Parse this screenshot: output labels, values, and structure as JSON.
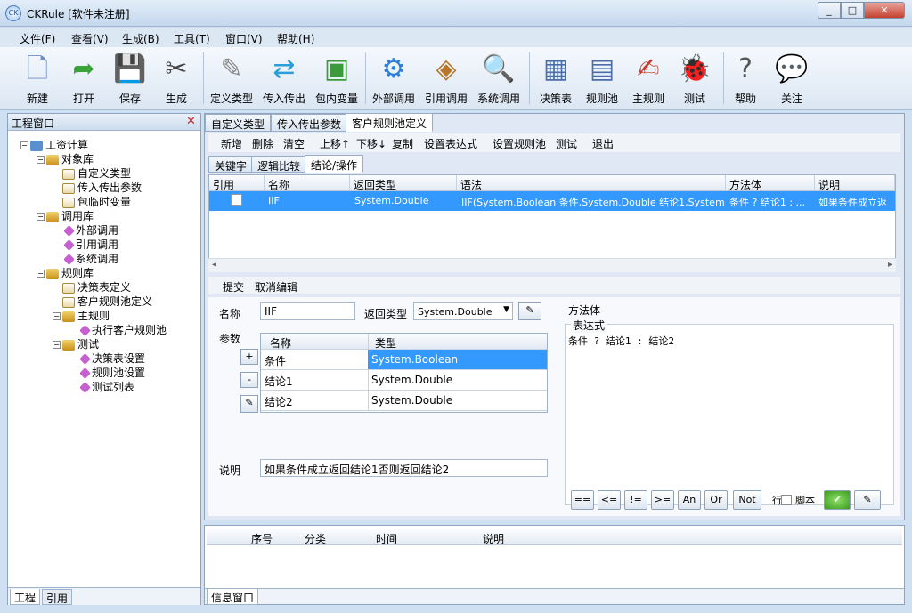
{
  "window": {
    "title": "CKRule [软件未注册]",
    "app_icon": "CK"
  },
  "menu": [
    "文件(F)",
    "查看(V)",
    "生成(B)",
    "工具(T)",
    "窗口(V)",
    "帮助(H)"
  ],
  "toolbar": [
    {
      "label": "新建",
      "icon": "new-file-icon"
    },
    {
      "label": "打开",
      "icon": "open-arrow-icon"
    },
    {
      "label": "保存",
      "icon": "floppy-save-icon"
    },
    {
      "label": "生成",
      "icon": "tools-build-icon"
    },
    {
      "label": "定义类型",
      "icon": "define-type-icon"
    },
    {
      "label": "传入传出",
      "icon": "in-out-arrows-icon"
    },
    {
      "label": "包内变量",
      "icon": "package-variable-icon"
    },
    {
      "label": "外部调用",
      "icon": "gear-external-call-icon"
    },
    {
      "label": "引用调用",
      "icon": "box-reference-icon"
    },
    {
      "label": "系统调用",
      "icon": "magnifier-system-icon"
    },
    {
      "label": "决策表",
      "icon": "decision-table-icon"
    },
    {
      "label": "规则池",
      "icon": "rule-pool-icon"
    },
    {
      "label": "主规则",
      "icon": "main-rule-icon"
    },
    {
      "label": "测试",
      "icon": "ladybug-test-icon"
    },
    {
      "label": "帮助",
      "icon": "help-question-icon"
    },
    {
      "label": "关注",
      "icon": "follow-icon"
    }
  ],
  "left_panel": {
    "title": "工程窗口",
    "tree": [
      {
        "label": "工资计算",
        "level": 0,
        "kind": "root",
        "expanded": true
      },
      {
        "label": "对象库",
        "level": 1,
        "kind": "lib",
        "expanded": true
      },
      {
        "label": "自定义类型",
        "level": 2,
        "kind": "doc"
      },
      {
        "label": "传入传出参数",
        "level": 2,
        "kind": "doc"
      },
      {
        "label": "包临时变量",
        "level": 2,
        "kind": "doc"
      },
      {
        "label": "调用库",
        "level": 1,
        "kind": "lib",
        "expanded": true
      },
      {
        "label": "外部调用",
        "level": 2,
        "kind": "dia"
      },
      {
        "label": "引用调用",
        "level": 2,
        "kind": "dia"
      },
      {
        "label": "系统调用",
        "level": 2,
        "kind": "dia"
      },
      {
        "label": "规则库",
        "level": 1,
        "kind": "lib",
        "expanded": true
      },
      {
        "label": "决策表定义",
        "level": 2,
        "kind": "doc"
      },
      {
        "label": "客户规则池定义",
        "level": 2,
        "kind": "doc"
      },
      {
        "label": "主规则",
        "level": 2,
        "kind": "lib",
        "expanded": true
      },
      {
        "label": "执行客户规则池",
        "level": 3,
        "kind": "dia"
      },
      {
        "label": "测试",
        "level": 2,
        "kind": "lib",
        "expanded": true
      },
      {
        "label": "决策表设置",
        "level": 3,
        "kind": "dia"
      },
      {
        "label": "规则池设置",
        "level": 3,
        "kind": "dia"
      },
      {
        "label": "测试列表",
        "level": 3,
        "kind": "dia"
      }
    ],
    "bottom_tabs": [
      "工程",
      "引用"
    ]
  },
  "doc_tabs": [
    "自定义类型",
    "传入传出参数",
    "客户规则池定义"
  ],
  "sub_toolbar": [
    "新增",
    "删除",
    "清空",
    "上移↑",
    "下移↓",
    "复制",
    "设置表达式",
    "设置规则池",
    "测试",
    "退出"
  ],
  "inner_tabs": [
    "关键字",
    "逻辑比较",
    "结论/操作"
  ],
  "grid": {
    "headers": [
      "引用",
      "名称",
      "返回类型",
      "语法",
      "方法体",
      "说明"
    ],
    "rows": [
      {
        "ref": "",
        "name": "IIF",
        "return_type": "System.Double",
        "syntax": "IIF(System.Boolean 条件,System.Double 结论1,System.Do...",
        "body": "条件 ? 结论1 : ...",
        "desc": "如果条件成立返"
      }
    ]
  },
  "edit_bar": [
    "提交",
    "取消编辑"
  ],
  "form": {
    "name_label": "名称",
    "name_value": "IIF",
    "return_label": "返回类型",
    "return_value": "System.Double",
    "params_label": "参数",
    "param_headers": [
      "名称",
      "类型"
    ],
    "params": [
      {
        "name": "条件",
        "type": "System.Boolean"
      },
      {
        "name": "结论1",
        "type": "System.Double"
      },
      {
        "name": "结论2",
        "type": "System.Double"
      }
    ],
    "add_btn": "+",
    "remove_btn": "-",
    "desc_label": "说明",
    "desc_value": "如果条件成立返回结论1否则返回结论2",
    "body_label": "方法体",
    "expr_label": "表达式",
    "expr_value": "条件 ? 结论1 : 结论2",
    "ops": [
      "==",
      "<=",
      "!=",
      ">=",
      "An",
      "Or",
      "Not"
    ],
    "row_label": "行",
    "script_label": "脚本"
  },
  "info_panel": {
    "headers": [
      "序号",
      "分类",
      "时间",
      "说明"
    ],
    "tab": "信息窗口"
  },
  "colors": {
    "selection": "#3399ff",
    "accent": "#c660d2"
  }
}
